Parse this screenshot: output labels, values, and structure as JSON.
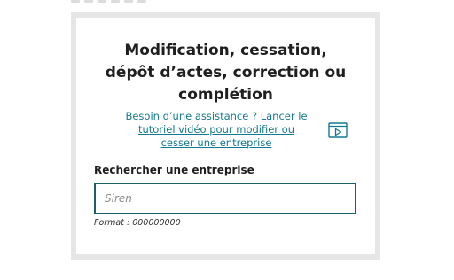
{
  "card": {
    "title_line1": "Modification, cessation,",
    "title_line2": "dépôt d’actes, correction ou",
    "title_line3": "complétion",
    "assist_line1": "Besoin d’une assistance ? Lancer le",
    "assist_line2": "tutoriel vidéo pour modifier ou",
    "assist_line3": "cesser une entreprise",
    "assist_icon": "video-play-icon",
    "search_label": "Rechercher une entreprise",
    "search_placeholder": "Siren",
    "search_value": "",
    "format_hint": "Format : 000000000"
  },
  "colors": {
    "link": "#137a8f",
    "input_border": "#1b5f6b",
    "frame": "#e6e6e6"
  }
}
